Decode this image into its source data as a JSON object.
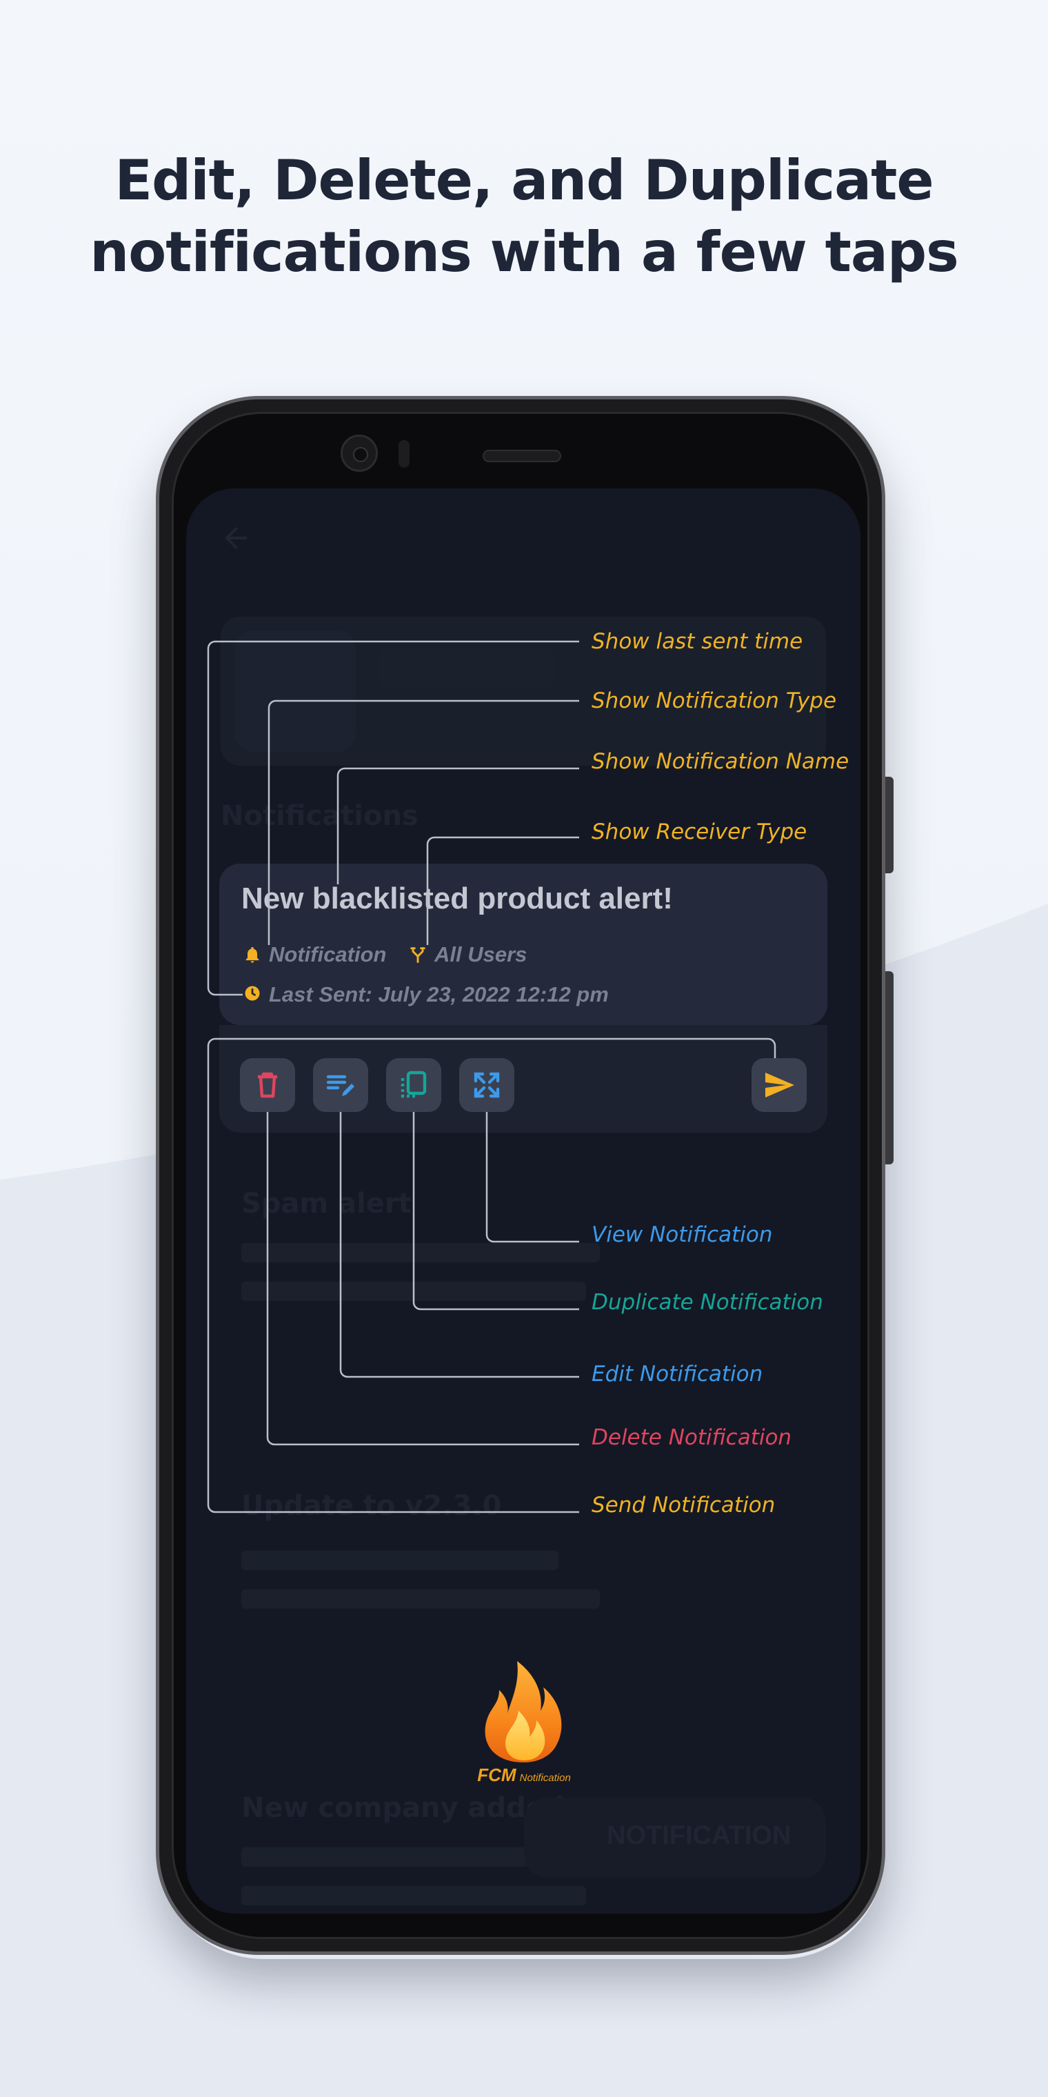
{
  "headline": {
    "line1": "Edit, Delete, and Duplicate",
    "line2": "notifications with a few taps"
  },
  "card": {
    "title": "New blacklisted product alert!",
    "type": "Notification",
    "receiver": "All Users",
    "last_sent": "Last Sent: July 23, 2022 12:12 pm"
  },
  "actions": [
    {
      "name": "delete",
      "icon": "trash-icon",
      "color": "#e0455f"
    },
    {
      "name": "edit",
      "icon": "edit-icon",
      "color": "#3d9aea"
    },
    {
      "name": "duplicate",
      "icon": "duplicate-icon",
      "color": "#16a59a"
    },
    {
      "name": "view",
      "icon": "expand-icon",
      "color": "#3d9aea"
    },
    {
      "name": "send",
      "icon": "send-icon",
      "color": "#f3b022"
    }
  ],
  "callouts": {
    "last_sent_time": "Show last sent time",
    "notification_type": "Show Notification Type",
    "notification_name": "Show Notification Name",
    "receiver_type": "Show Receiver Type",
    "view": "View Notification",
    "duplicate": "Duplicate Notification",
    "edit": "Edit Notification",
    "delete": "Delete Notification",
    "send": "Send Notification"
  },
  "callout_colors": {
    "yellow": "#f0b323",
    "blue": "#3d9aea",
    "teal": "#16a59a",
    "red": "#e0455f"
  },
  "logo": {
    "brand": "FCM",
    "sub": "Notification"
  },
  "background_screen": {
    "header_label": "Notifications",
    "fab_label": "NOTIFICATION",
    "list": [
      {
        "title": "Spam alert"
      },
      {
        "title": "Update to v2.3.0"
      },
      {
        "title": "New company added"
      }
    ]
  }
}
